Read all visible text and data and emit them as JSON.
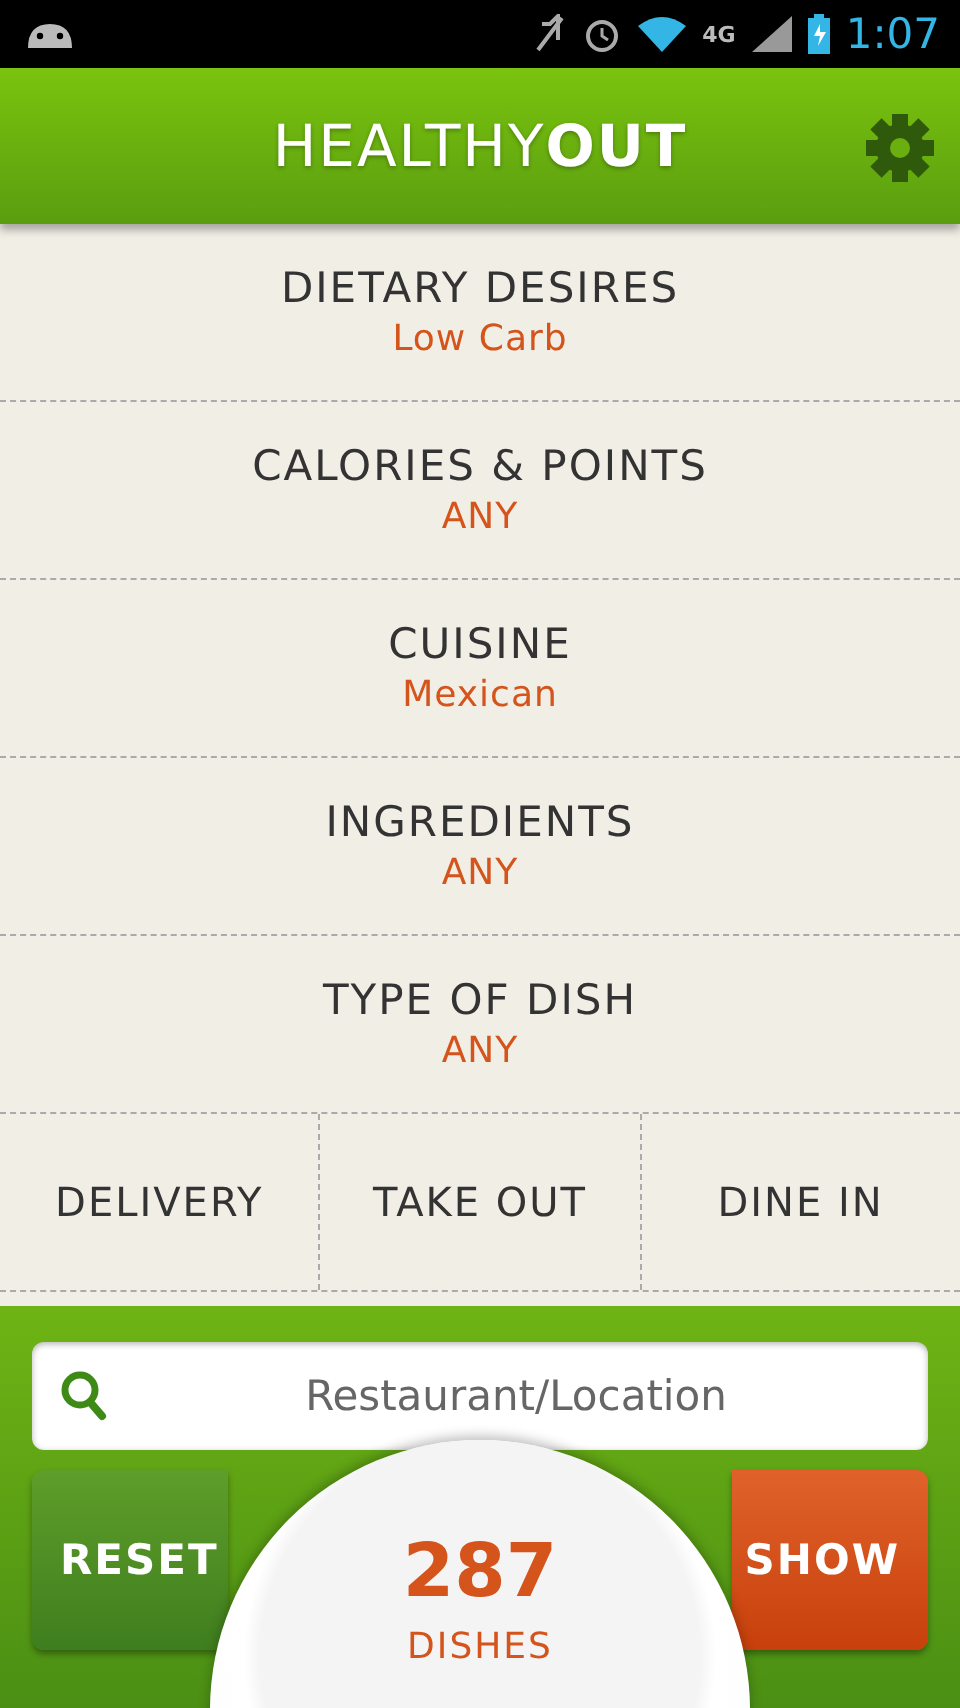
{
  "status_bar": {
    "network": "4G",
    "time": "1:07"
  },
  "header": {
    "title": "HEALTHY**OUT**"
  },
  "filters": [
    {
      "label": "DIETARY DESIRES",
      "value": "Low Carb"
    },
    {
      "label": "CALORIES & POINTS",
      "value": "ANY"
    },
    {
      "label": "CUISINE",
      "value": "Mexican"
    },
    {
      "label": "INGREDIENTS",
      "value": "ANY"
    },
    {
      "label": "TYPE OF DISH",
      "value": "ANY"
    }
  ],
  "service_modes": [
    {
      "label": "DELIVERY"
    },
    {
      "label": "TAKE OUT"
    },
    {
      "label": "DINE IN"
    }
  ],
  "search": {
    "placeholder": "Restaurant/Location"
  },
  "actions": {
    "reset": "RESET",
    "show": "SHOW"
  },
  "counter": {
    "count": "287",
    "unit": "DISHES"
  }
}
